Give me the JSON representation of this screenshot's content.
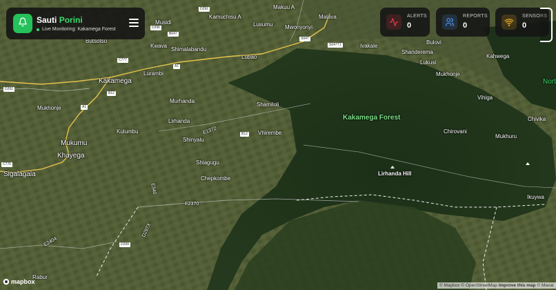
{
  "app": {
    "name_part1": "Sauti",
    "name_part2": "Porini",
    "status_text": "Live Monitoring: Kakamega Forest"
  },
  "stats": [
    {
      "key": "alerts",
      "label": "ALERTS",
      "value": "0",
      "icon": "activity-icon",
      "color": "#e0384a"
    },
    {
      "key": "reports",
      "label": "REPORTS",
      "value": "0",
      "icon": "users-icon",
      "color": "#4a8fe7"
    },
    {
      "key": "sensors",
      "label": "SENSORS",
      "value": "0",
      "icon": "wifi-icon",
      "color": "#f0b429"
    }
  ],
  "map": {
    "places": [
      "Malava",
      "Makuu A",
      "Kamuchisu A",
      "Musidi",
      "Lusumu",
      "Mwonyonyi",
      "Butsotso",
      "Kwava",
      "Shimalabandu",
      "Lubao",
      "Lurambi",
      "Ivakale",
      "Bulovi",
      "Shanderema",
      "Kahwega",
      "Lukusi",
      "Mukhonje",
      "Kakamega",
      "Mukhonje",
      "Murhanda",
      "Shamiloli",
      "Vihiga",
      "Lirhanda",
      "Kulumbu",
      "Shinyalu",
      "Vhirembe",
      "Chirovani",
      "Chivika",
      "Mukumu",
      "Mukhuru",
      "Khayega",
      "Sigalagala",
      "Shiagugu",
      "Chepkombe",
      "Ikuywa",
      "Rabur",
      "Nort"
    ],
    "forest_label": "Kakamega Forest",
    "peak_label": "Lirhanda Hill",
    "road_labels": [
      "A1",
      "A1",
      "B12",
      "B12",
      "C777",
      "D262",
      "C776",
      "E2370",
      "E1372",
      "D299",
      "E2404",
      "D297X",
      "E340",
      "D292",
      "D296",
      "B047",
      "S047",
      "S047T1"
    ]
  },
  "footer": {
    "logo_text": "mapbox",
    "attribution_1": "© Mapbox",
    "attribution_2": "© OpenStreetMap",
    "attribution_3": "Improve this map",
    "attribution_4": "© Maxar"
  }
}
